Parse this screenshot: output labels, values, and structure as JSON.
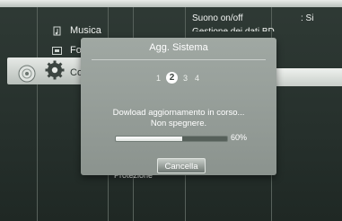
{
  "sidebar": {
    "items": [
      {
        "label": "Musica",
        "icon": "music-icon"
      },
      {
        "label": "Fot",
        "icon": "photo-icon"
      },
      {
        "label": "Co",
        "icon": "gear-icon"
      }
    ],
    "disc_icon": "disc-icon"
  },
  "right_panel": {
    "rows": [
      {
        "label": "Suono on/off",
        "value": ": Si"
      },
      {
        "label": "Gestione dei dati BD"
      }
    ],
    "bottom_item": "Protezione"
  },
  "dialog": {
    "title": "Agg. Sistema",
    "steps": [
      "1",
      "2",
      "3",
      "4"
    ],
    "current_step": "2",
    "message_line1": "Dowload aggiornamento in corso...",
    "message_line2": "Non spegnere.",
    "progress": 60,
    "progress_label": "60%",
    "cancel_label": "Cancella"
  },
  "colors": {
    "background": "#26302c",
    "dialog": "#959d98",
    "accent": "#ffffff"
  }
}
